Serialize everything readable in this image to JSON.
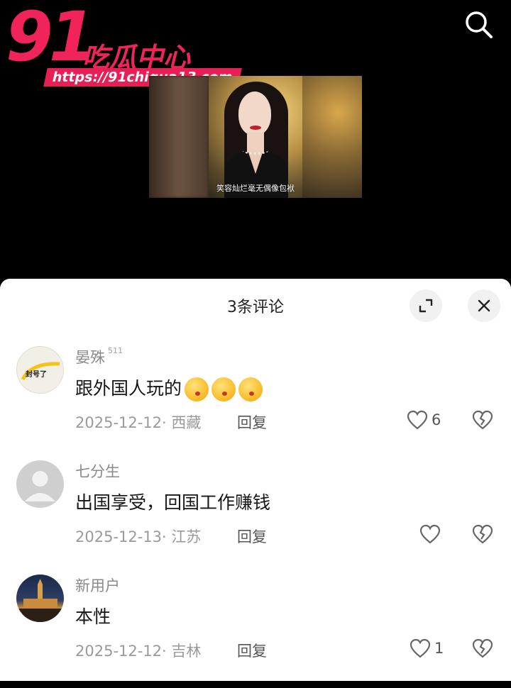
{
  "logo": {
    "number": "91",
    "brand": "吃瓜中心",
    "url": "https://91chigua13.com"
  },
  "video": {
    "subtitle": "笑容灿烂毫无偶像包袱"
  },
  "sheet": {
    "title": "3条评论"
  },
  "comments": [
    {
      "username": "晏殊",
      "badge": "511",
      "avatar_text": "封号了",
      "text": "跟外国人玩的",
      "emoji": [
        "kiss-emoji",
        "kiss-emoji",
        "kiss-emoji"
      ],
      "date_location": "2025-12-12· 西藏",
      "reply_label": "回复",
      "likes": "6"
    },
    {
      "username": "七分生",
      "text": "出国享受，回国工作赚钱",
      "date_location": "2025-12-13· 江苏",
      "reply_label": "回复",
      "likes": ""
    },
    {
      "username": "新用户",
      "text": "本性",
      "date_location": "2025-12-12· 吉林",
      "reply_label": "回复",
      "likes": "1"
    }
  ],
  "colors": {
    "brand": "#f0245a",
    "sheet_bg": "#ffffff",
    "muted_text": "#9a9a9a"
  },
  "icons": [
    "search-icon",
    "expand-icon",
    "close-icon",
    "heart-icon",
    "broken-heart-icon"
  ]
}
